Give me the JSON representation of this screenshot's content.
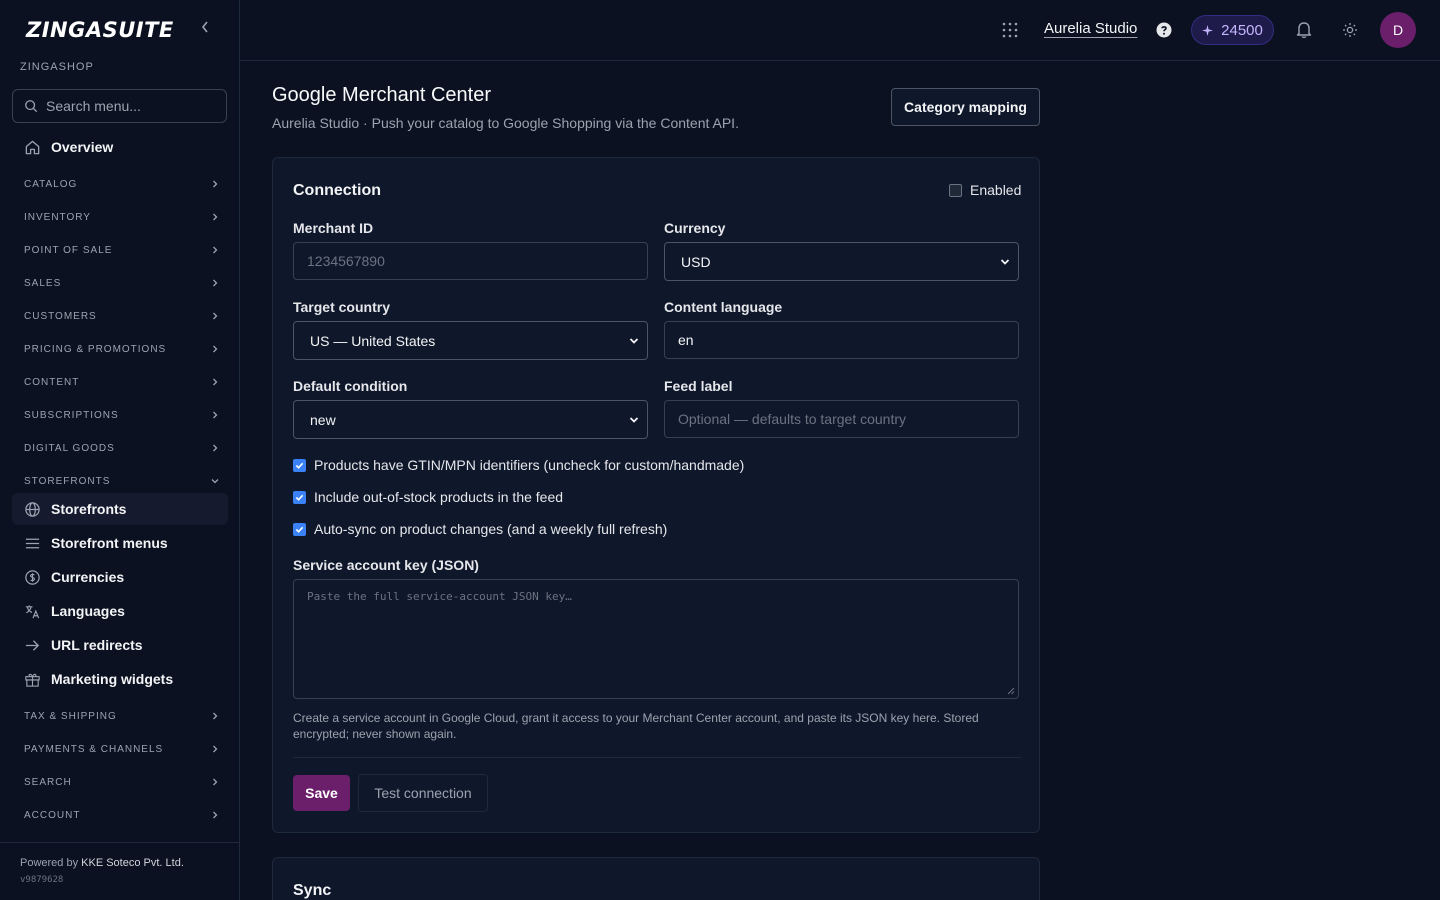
{
  "sidebar": {
    "brand": "ZINGASUITE",
    "shop_name": "ZINGASHOP",
    "search_placeholder": "Search menu...",
    "overview_label": "Overview",
    "sections_top": [
      "CATALOG",
      "INVENTORY",
      "POINT OF SALE",
      "SALES",
      "CUSTOMERS",
      "PRICING & PROMOTIONS",
      "CONTENT",
      "SUBSCRIPTIONS",
      "DIGITAL GOODS"
    ],
    "storefronts_section": "STOREFRONTS",
    "storefront_items": [
      {
        "label": "Storefronts",
        "icon": "globe-icon"
      },
      {
        "label": "Storefront menus",
        "icon": "menu-lines-icon"
      },
      {
        "label": "Currencies",
        "icon": "currency-icon"
      },
      {
        "label": "Languages",
        "icon": "translate-icon"
      },
      {
        "label": "URL redirects",
        "icon": "arrow-right-icon"
      },
      {
        "label": "Marketing widgets",
        "icon": "gift-icon"
      }
    ],
    "sections_bottom": [
      "TAX & SHIPPING",
      "PAYMENTS & CHANNELS",
      "SEARCH",
      "ACCOUNT"
    ],
    "footer": {
      "powered_prefix": "Powered by",
      "powered_company": "KKE Soteco Pvt. Ltd.",
      "version": "v9879628"
    }
  },
  "topbar": {
    "store_name": "Aurelia Studio",
    "credits": "24500",
    "avatar_initial": "D",
    "colors": {
      "avatar": "#6b1f6b",
      "credits_bg": "#1e1b4b"
    }
  },
  "page": {
    "title": "Google Merchant Center",
    "subtitle": "Aurelia Studio · Push your catalog to Google Shopping via the Content API.",
    "category_mapping_label": "Category mapping"
  },
  "connection": {
    "title": "Connection",
    "enabled_label": "Enabled",
    "enabled": false,
    "merchant_id": {
      "label": "Merchant ID",
      "placeholder": "1234567890"
    },
    "currency": {
      "label": "Currency",
      "value": "USD"
    },
    "target_country": {
      "label": "Target country",
      "value": "US — United States"
    },
    "content_language": {
      "label": "Content language",
      "value": "en"
    },
    "default_condition": {
      "label": "Default condition",
      "value": "new"
    },
    "feed_label": {
      "label": "Feed label",
      "placeholder": "Optional — defaults to target country"
    },
    "checkboxes": [
      {
        "label": "Products have GTIN/MPN identifiers (uncheck for custom/handmade)",
        "checked": true
      },
      {
        "label": "Include out-of-stock products in the feed",
        "checked": true
      },
      {
        "label": "Auto-sync on product changes (and a weekly full refresh)",
        "checked": true
      }
    ],
    "service_key": {
      "label": "Service account key (JSON)",
      "placeholder": "Paste the full service-account JSON key…",
      "help": "Create a service account in Google Cloud, grant it access to your Merchant Center account, and paste its JSON key here. Stored encrypted; never shown again."
    },
    "save_label": "Save",
    "test_label": "Test connection",
    "accent_color": "#6b1f6b"
  },
  "sync": {
    "title": "Sync"
  }
}
